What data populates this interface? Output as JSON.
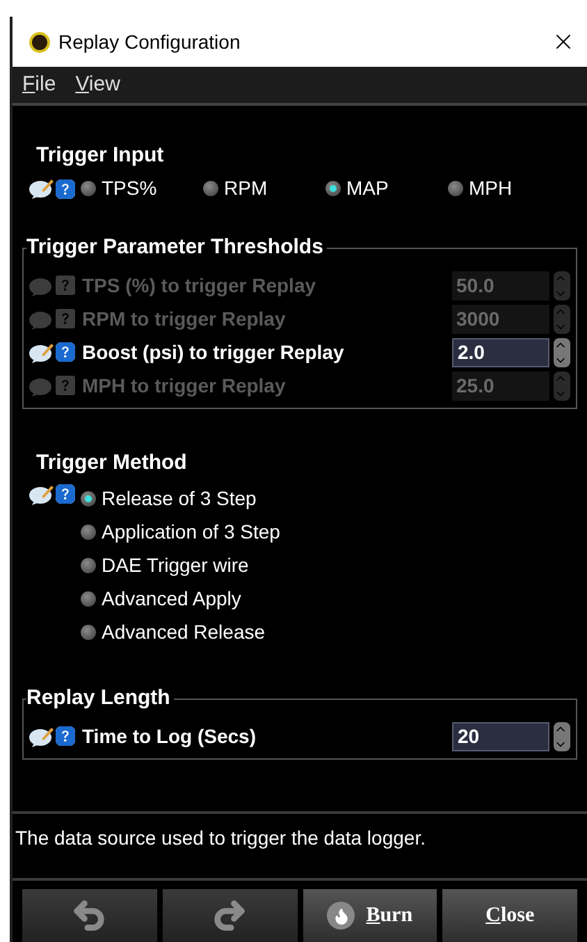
{
  "window": {
    "title": "Replay Configuration"
  },
  "menu": [
    {
      "label": "File"
    },
    {
      "label": "View"
    }
  ],
  "trigger_input": {
    "title": "Trigger Input",
    "options": [
      {
        "label": "TPS%",
        "selected": false
      },
      {
        "label": "RPM",
        "selected": false
      },
      {
        "label": "MAP",
        "selected": true
      },
      {
        "label": "MPH",
        "selected": false
      }
    ]
  },
  "thresholds": {
    "title": "Trigger Parameter Thresholds",
    "rows": [
      {
        "label": "TPS (%) to trigger Replay",
        "value": "50.0",
        "disabled": true
      },
      {
        "label": "RPM to trigger Replay",
        "value": "3000",
        "disabled": true
      },
      {
        "label": "Boost (psi) to trigger Replay",
        "value": "2.0",
        "disabled": false
      },
      {
        "label": "MPH to trigger Replay",
        "value": "25.0",
        "disabled": true
      }
    ]
  },
  "trigger_method": {
    "title": "Trigger Method",
    "options": [
      {
        "label": "Release of 3 Step",
        "selected": true
      },
      {
        "label": "Application of 3 Step",
        "selected": false
      },
      {
        "label": "DAE Trigger wire",
        "selected": false
      },
      {
        "label": "Advanced Apply",
        "selected": false
      },
      {
        "label": "Advanced Release",
        "selected": false
      }
    ]
  },
  "replay_length": {
    "title": "Replay Length",
    "rows": [
      {
        "label": "Time to Log (Secs)",
        "value": "20",
        "disabled": false
      }
    ]
  },
  "help_text": "The data source used to trigger the data logger.",
  "buttons": [
    {
      "kind": "undo"
    },
    {
      "kind": "redo"
    },
    {
      "kind": "burn",
      "label": "Burn"
    },
    {
      "kind": "close",
      "label": "Close"
    }
  ]
}
